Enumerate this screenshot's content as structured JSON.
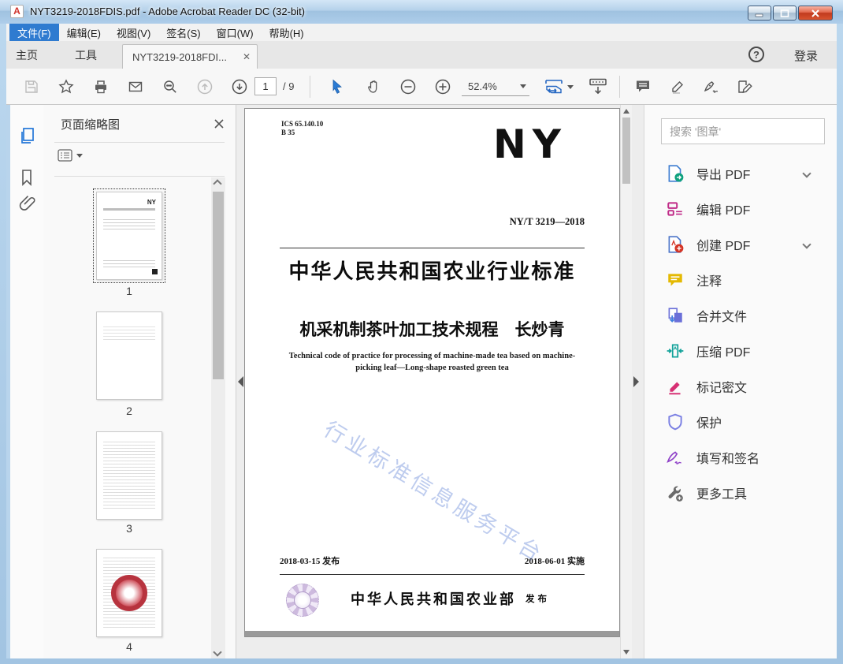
{
  "window": {
    "title": "NYT3219-2018FDIS.pdf - Adobe Acrobat Reader DC (32-bit)"
  },
  "menu": {
    "items": [
      {
        "label": "文件(F)"
      },
      {
        "label": "编辑(E)"
      },
      {
        "label": "视图(V)"
      },
      {
        "label": "签名(S)"
      },
      {
        "label": "窗口(W)"
      },
      {
        "label": "帮助(H)"
      }
    ]
  },
  "tabbar": {
    "home": "主页",
    "tools": "工具",
    "doc_tab": "NYT3219-2018FDI...",
    "login": "登录",
    "help": "?"
  },
  "toolbar": {
    "page_current": "1",
    "page_total": "/ 9",
    "zoom_level": "52.4%"
  },
  "thumbnails_panel": {
    "title": "页面缩略图",
    "pages": [
      {
        "num": "1"
      },
      {
        "num": "2"
      },
      {
        "num": "3"
      },
      {
        "num": "4"
      }
    ]
  },
  "document": {
    "ics_line1": "ICS 65.140.10",
    "ics_line2": "B 35",
    "logo": "NY",
    "header": "中华人民共和国农业行业标准",
    "std_number": "NY/T 3219—2018",
    "title_cn": "机采机制茶叶加工技术规程　长炒青",
    "title_en_1": "Technical code of practice for processing of machine-made tea based on machine-",
    "title_en_2": "picking leaf—Long-shape roasted green tea",
    "watermark": "行业标准信息服务平台",
    "date_issue": "2018-03-15 发布",
    "date_impl": "2018-06-01 实施",
    "publisher": "中华人民共和国农业部",
    "publish_word": "发布"
  },
  "right_panel": {
    "search_placeholder": "搜索 '图章'",
    "tools": [
      {
        "label": "导出 PDF"
      },
      {
        "label": "编辑 PDF"
      },
      {
        "label": "创建 PDF"
      },
      {
        "label": "注释"
      },
      {
        "label": "合并文件"
      },
      {
        "label": "压缩 PDF"
      },
      {
        "label": "标记密文"
      },
      {
        "label": "保护"
      },
      {
        "label": "填写和签名"
      },
      {
        "label": "更多工具"
      }
    ]
  },
  "colors": {
    "accent_blue": "#2b7bd4",
    "export_teal": "#0fa17e",
    "edit_magenta": "#c02b88",
    "create_red": "#d43425",
    "comment_yellow": "#e4b902",
    "combine_purple": "#6a6fd8",
    "compress_teal": "#12a29a",
    "redact_pink": "#d62f73",
    "protect_indigo": "#7b80e3",
    "sign_purple": "#9043c9",
    "watermark_blue": "#b3c4ec",
    "menu_highlight": "#2f7bd0"
  }
}
